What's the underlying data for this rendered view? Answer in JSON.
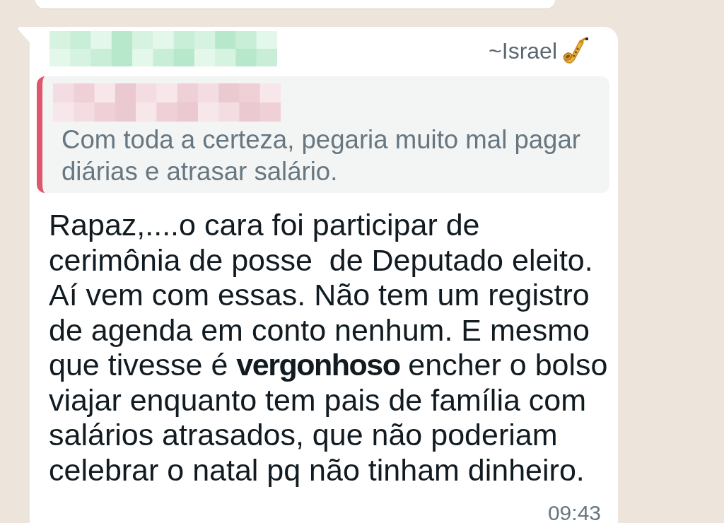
{
  "message": {
    "sender": "~Israel",
    "quote": {
      "text": "Com toda a certeza, pegaria muito mal pagar\ndiárias e atrasar salário."
    },
    "text": "Rapaz,....o cara foi participar de\ncerimônia de posse  de Deputado eleito.\nAí vem com essas. Não tem um registro\nde agenda em conto nenhum. E mesmo\nque tivesse é **vergonhoso** encher o bolso\nviajar enquanto tem pais de família com\nsalários atrasados, que não poderiam\ncelebrar o natal pq não tinham dinheiro.",
    "time": "09:43"
  }
}
